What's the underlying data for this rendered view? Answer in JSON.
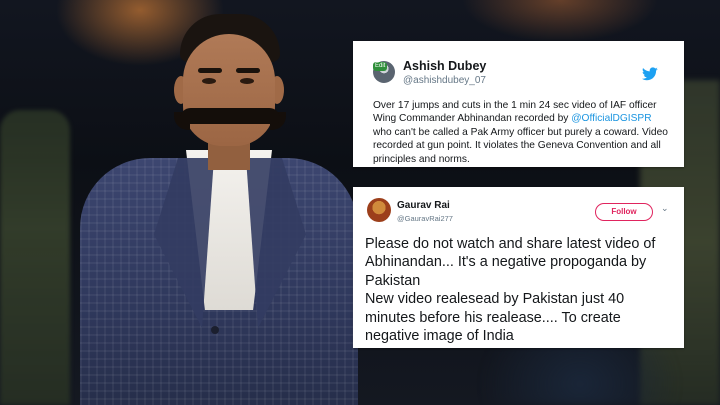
{
  "tweets": [
    {
      "avatar_badge": "Edit",
      "name": "Ashish Dubey",
      "handle": "@ashishdubey_07",
      "text_before": "Over 17 jumps and cuts in the 1 min 24 sec video of IAF officer Wing Commander Abhinandan recorded by ",
      "mention": "@OfficialDGISPR",
      "text_after": " who can't be called a Pak Army officer but purely a coward. Video recorded at gun point. It violates the Geneva Convention and all principles and norms.",
      "brand_icon": "twitter-bird-icon"
    },
    {
      "name": "Gaurav Rai",
      "handle": "@GauravRai277",
      "follow_label": "Follow",
      "caret_icon": "chevron-down-icon",
      "text": "Please do not watch and share latest video of Abhinandan... It's a negative propoganda by Pakistan\nNew video realesead by Pakistan just 40 minutes before his realease.... To create negative image of India"
    }
  ],
  "colors": {
    "twitter_blue": "#1da1f2",
    "mention_blue": "#1b95e0",
    "follow_red": "#e0245e"
  }
}
